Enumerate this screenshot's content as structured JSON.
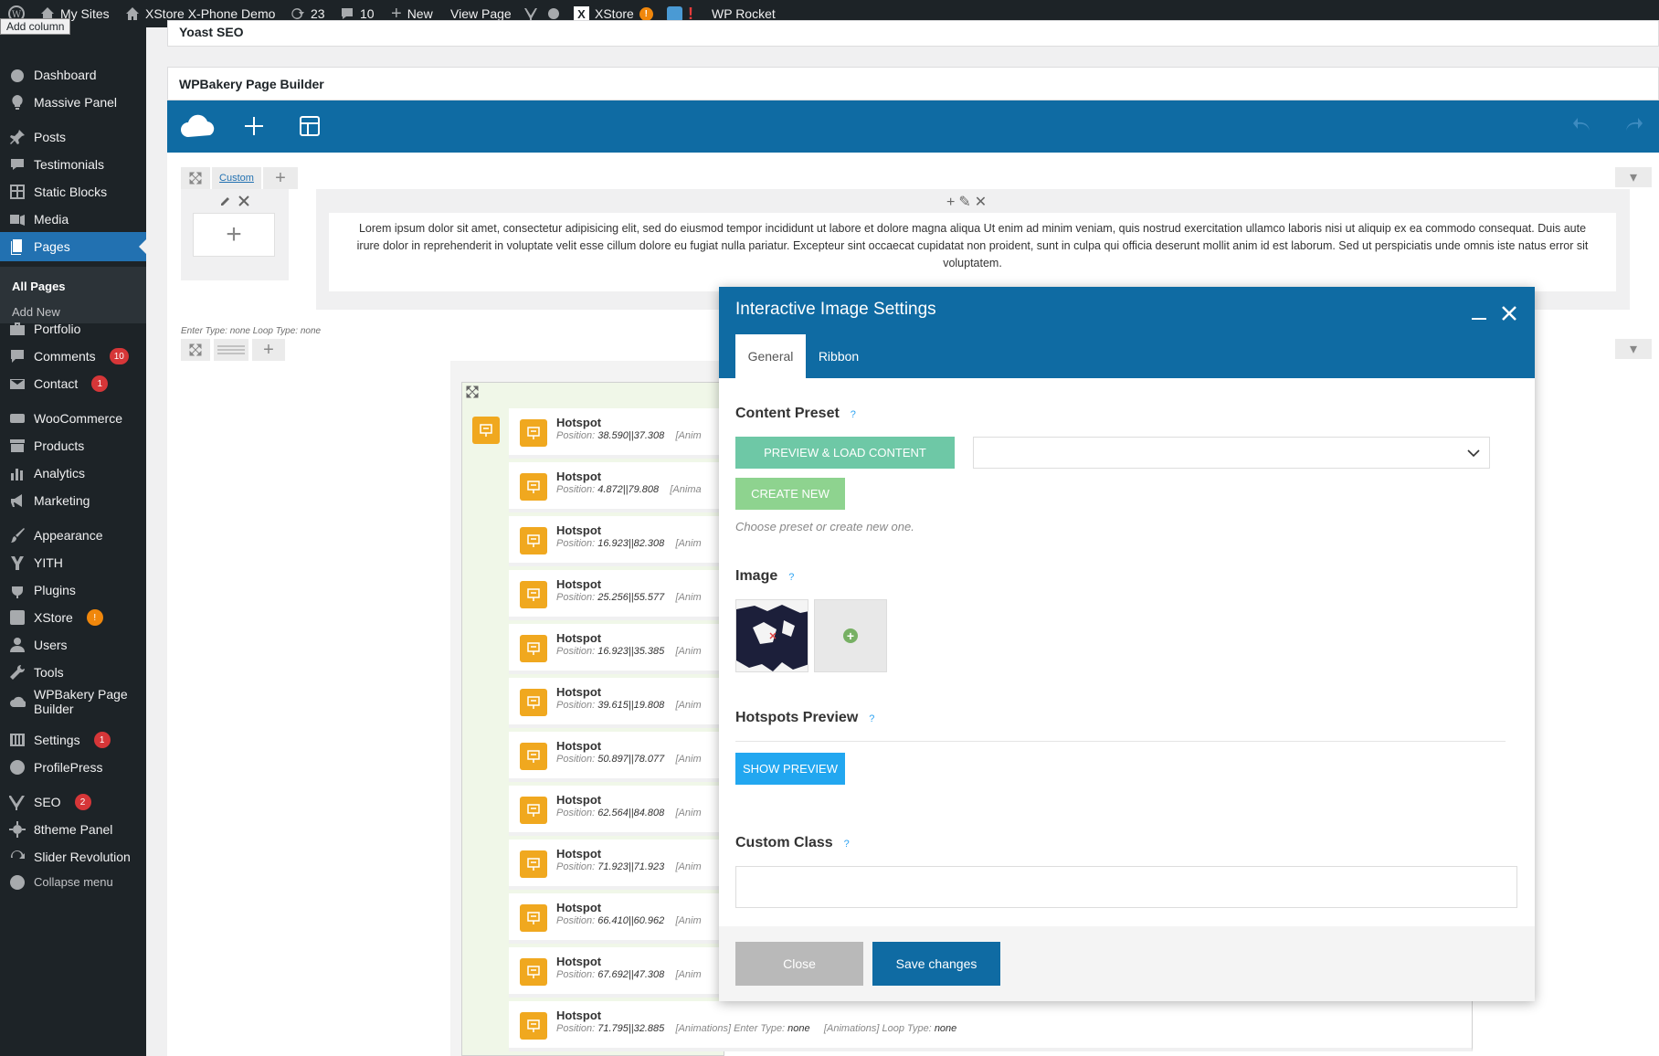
{
  "adminbar": {
    "my_sites": "My Sites",
    "site": "XStore X-Phone Demo",
    "updates": "23",
    "comments": "10",
    "new": "New",
    "view_page": "View Page",
    "xstore": "XStore",
    "xstore_alert": "!",
    "wp_rocket": "WP Rocket",
    "add_column_tip": "Add column"
  },
  "sidebar": {
    "items": [
      {
        "label": "Dashboard",
        "icon": "dashboard-icon"
      },
      {
        "label": "Massive Panel",
        "icon": "lightbulb-icon"
      },
      {
        "label": "Posts",
        "icon": "pin-icon"
      },
      {
        "label": "Testimonials",
        "icon": "speech-bubble-icon"
      },
      {
        "label": "Static Blocks",
        "icon": "grid-icon"
      },
      {
        "label": "Media",
        "icon": "media-icon"
      },
      {
        "label": "Pages",
        "icon": "pages-icon"
      },
      {
        "label": "Portfolio",
        "icon": "portfolio-icon"
      },
      {
        "label": "Comments",
        "icon": "comment-icon",
        "badge": "10"
      },
      {
        "label": "Contact",
        "icon": "mail-icon",
        "badge": "1"
      },
      {
        "label": "WooCommerce",
        "icon": "woo-icon"
      },
      {
        "label": "Products",
        "icon": "archive-icon"
      },
      {
        "label": "Analytics",
        "icon": "bar-chart-icon"
      },
      {
        "label": "Marketing",
        "icon": "megaphone-icon"
      },
      {
        "label": "Appearance",
        "icon": "brush-icon"
      },
      {
        "label": "YITH",
        "icon": "yith-icon"
      },
      {
        "label": "Plugins",
        "icon": "plug-icon"
      },
      {
        "label": "XStore",
        "icon": "xstore-icon",
        "badge": "!"
      },
      {
        "label": "Users",
        "icon": "user-icon"
      },
      {
        "label": "Tools",
        "icon": "wrench-icon"
      },
      {
        "label": "WPBakery Page Builder",
        "icon": "cloud-icon"
      },
      {
        "label": "Settings",
        "icon": "sliders-icon",
        "badge": "1"
      },
      {
        "label": "ProfilePress",
        "icon": "profile-icon"
      },
      {
        "label": "SEO",
        "icon": "yoast-icon",
        "badge": "2"
      },
      {
        "label": "8theme Panel",
        "icon": "gear-icon"
      },
      {
        "label": "Slider Revolution",
        "icon": "refresh-icon"
      },
      {
        "label": "Collapse menu",
        "icon": "collapse-icon"
      }
    ],
    "submenu": {
      "all_pages": "All Pages",
      "add_new": "Add New"
    }
  },
  "editor": {
    "yoast_title": "Yoast SEO",
    "wpbakery_title": "WPBakery Page Builder",
    "custom_tab": "Custom",
    "lorem": "Lorem ipsum dolor sit amet, consectetur adipisicing elit, sed do eiusmod tempor incididunt ut labore et dolore magna aliqua Ut enim ad minim veniam, quis nostrud exercitation ullamco laboris nisi ut aliquip ex ea commodo consequat. Duis aute irure dolor in reprehenderit in voluptate velit esse cillum dolore eu fugiat nulla pariatur. Excepteur sint occaecat cupidatat non proident, sunt in culpa qui officia deserunt mollit anim id est laborum. Sed ut perspiciatis unde omnis iste natus error sit voluptatem.",
    "row_hint": "Enter Type: none  Loop Type: none"
  },
  "hotspots": [
    {
      "title": "Hotspot",
      "pos": "38.590||37.308",
      "anim": "[Anim"
    },
    {
      "title": "Hotspot",
      "pos": "4.872||79.808",
      "anim": "[Anima"
    },
    {
      "title": "Hotspot",
      "pos": "16.923||82.308",
      "anim": "[Anim"
    },
    {
      "title": "Hotspot",
      "pos": "25.256||55.577",
      "anim": "[Anim"
    },
    {
      "title": "Hotspot",
      "pos": "16.923||35.385",
      "anim": "[Anim"
    },
    {
      "title": "Hotspot",
      "pos": "39.615||19.808",
      "anim": "[Anim"
    },
    {
      "title": "Hotspot",
      "pos": "50.897||78.077",
      "anim": "[Anim"
    },
    {
      "title": "Hotspot",
      "pos": "62.564||84.808",
      "anim": "[Anim"
    },
    {
      "title": "Hotspot",
      "pos": "71.923||71.923",
      "anim": "[Anim"
    },
    {
      "title": "Hotspot",
      "pos": "66.410||60.962",
      "anim": "[Anim"
    },
    {
      "title": "Hotspot",
      "pos": "67.692||47.308",
      "anim": "[Anim"
    },
    {
      "title": "Hotspot",
      "pos": "71.795||32.885",
      "anim": "[Animations] Enter Type:",
      "enter": "none",
      "loop_lbl": "[Animations] Loop Type:",
      "loop": "none"
    }
  ],
  "position_label": "Position:",
  "modal": {
    "title": "Interactive Image Settings",
    "tabs": [
      "General",
      "Ribbon"
    ],
    "content_preset": "Content Preset",
    "preview_btn": "PREVIEW & LOAD CONTENT",
    "create_btn": "CREATE NEW",
    "preset_hint": "Choose preset or create new one.",
    "image": "Image",
    "hotspots_preview": "Hotspots Preview",
    "show_preview": "SHOW PREVIEW",
    "custom_class": "Custom Class",
    "custom_class_value": "",
    "close": "Close",
    "save": "Save changes",
    "help": "?"
  },
  "colors": {
    "wp_dark": "#1d2327",
    "wp_blue": "#2271b1",
    "vc_blue": "#0f6ba3",
    "preset_green": "#6ec8a6",
    "create_green": "#8ed38f",
    "preview_blue": "#22a7f0",
    "hotspot_orange": "#f0a81f"
  }
}
